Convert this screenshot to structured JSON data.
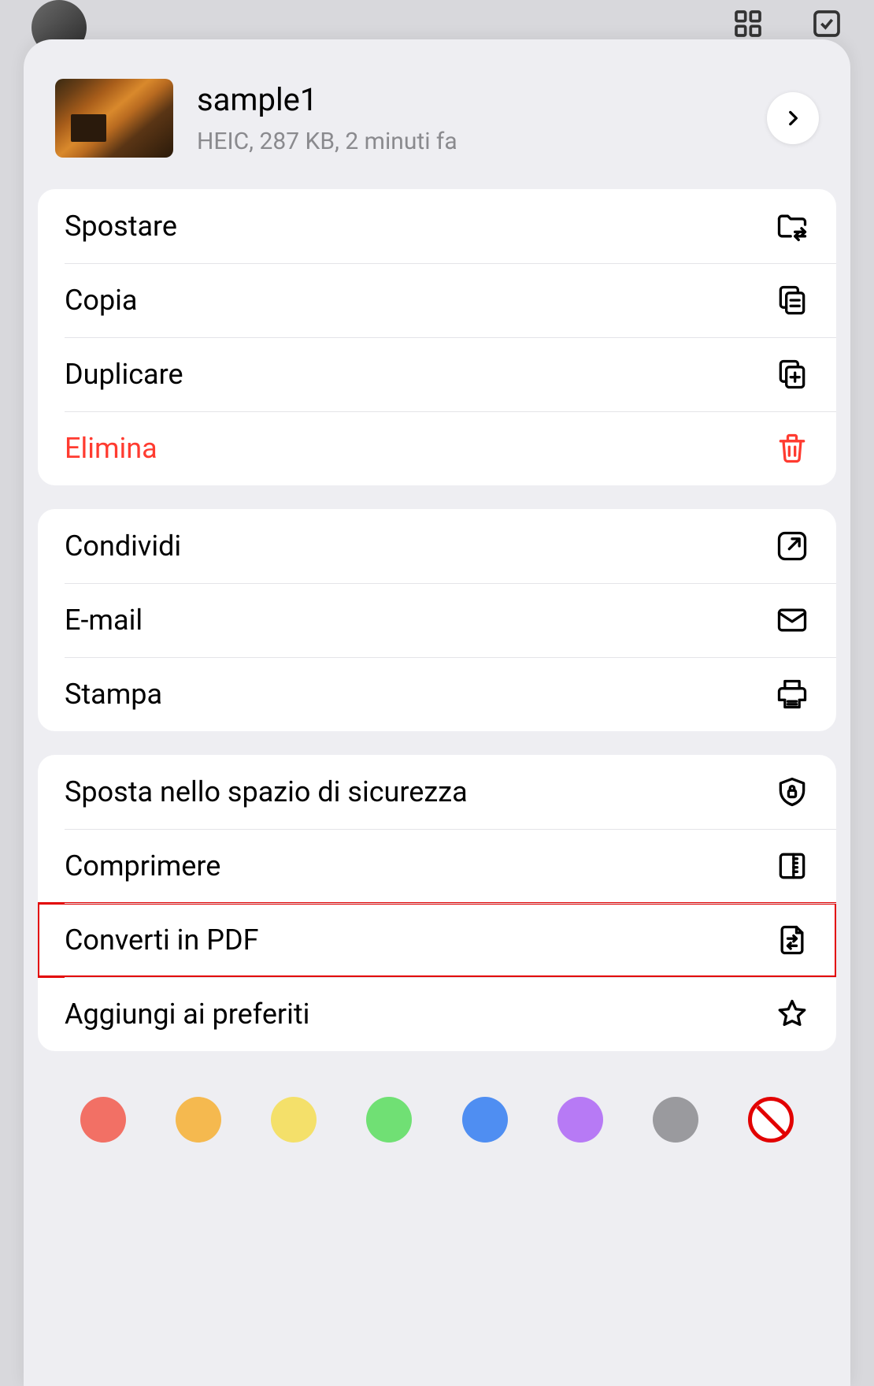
{
  "file": {
    "title": "sample1",
    "meta": "HEIC, 287 KB, 2 minuti fa"
  },
  "groups": [
    {
      "rows": [
        {
          "label": "Spostare",
          "icon": "folder-move-icon",
          "danger": false
        },
        {
          "label": "Copia",
          "icon": "copy-icon",
          "danger": false
        },
        {
          "label": "Duplicare",
          "icon": "duplicate-icon",
          "danger": false
        },
        {
          "label": "Elimina",
          "icon": "trash-icon",
          "danger": true
        }
      ]
    },
    {
      "rows": [
        {
          "label": "Condividi",
          "icon": "share-icon",
          "danger": false
        },
        {
          "label": "E-mail",
          "icon": "mail-icon",
          "danger": false
        },
        {
          "label": "Stampa",
          "icon": "print-icon",
          "danger": false
        }
      ]
    },
    {
      "rows": [
        {
          "label": "Sposta nello spazio di sicurezza",
          "icon": "shield-lock-icon",
          "danger": false
        },
        {
          "label": "Comprimere",
          "icon": "archive-icon",
          "danger": false
        },
        {
          "label": "Converti in PDF",
          "icon": "convert-icon",
          "danger": false,
          "highlight": true
        },
        {
          "label": "Aggiungi ai preferiti",
          "icon": "star-icon",
          "danger": false
        }
      ]
    }
  ],
  "colors": [
    {
      "name": "red",
      "hex": "#f27065"
    },
    {
      "name": "orange",
      "hex": "#f5b94f"
    },
    {
      "name": "yellow",
      "hex": "#f4e06a"
    },
    {
      "name": "green",
      "hex": "#70e074"
    },
    {
      "name": "blue",
      "hex": "#4f8ef2"
    },
    {
      "name": "purple",
      "hex": "#b77af5"
    },
    {
      "name": "gray",
      "hex": "#9a9a9e"
    },
    {
      "name": "none",
      "hex": null
    }
  ]
}
